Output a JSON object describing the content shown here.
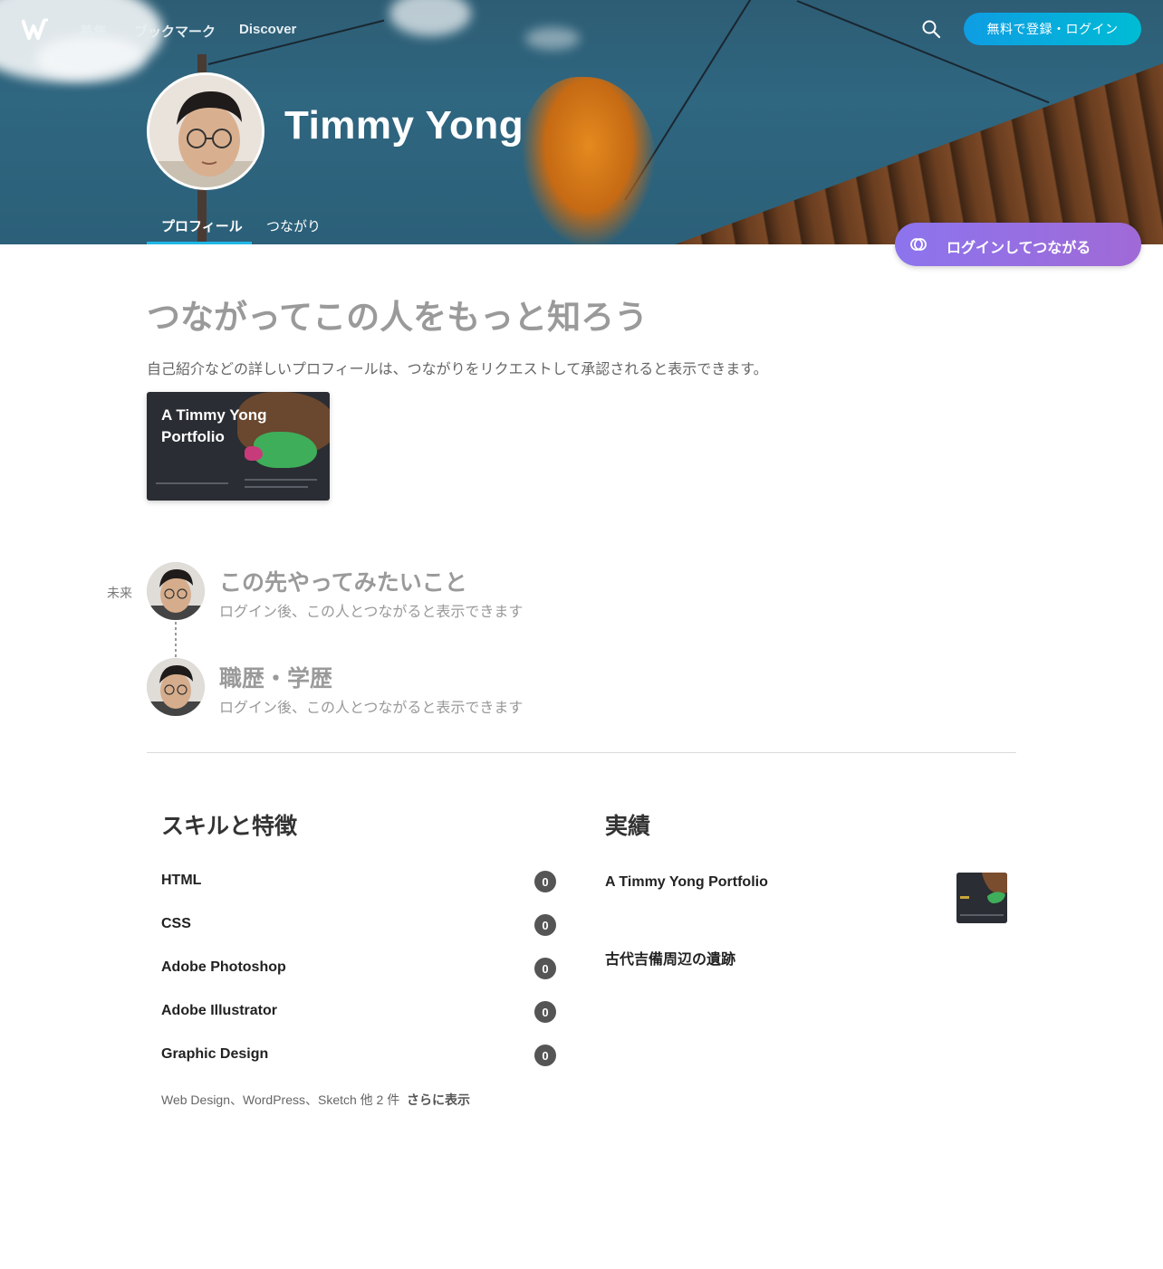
{
  "nav": {
    "logo_alt": "W",
    "links": [
      "募集",
      "ブックマーク",
      "Discover"
    ],
    "signup_label": "無料で登録・ログイン"
  },
  "profile": {
    "name": "Timmy Yong",
    "tabs": [
      "プロフィール",
      "つながり"
    ],
    "active_tab": 0,
    "connect_label": "ログインしてつながる"
  },
  "intro": {
    "heading": "つながってこの人をもっと知ろう",
    "description": "自己紹介などの詳しいプロフィールは、つながりをリクエストして承認されると表示できます。",
    "portfolio_card_title": "A Timmy Yong Portfolio"
  },
  "timeline": {
    "future_label": "未来",
    "items": [
      {
        "title": "この先やってみたいこと",
        "subtitle": "ログイン後、この人とつながると表示できます"
      },
      {
        "title": "職歴・学歴",
        "subtitle": "ログイン後、この人とつながると表示できます"
      }
    ]
  },
  "skills": {
    "title": "スキルと特徴",
    "items": [
      {
        "name": "HTML",
        "count": "0"
      },
      {
        "name": "CSS",
        "count": "0"
      },
      {
        "name": "Adobe Photoshop",
        "count": "0"
      },
      {
        "name": "Adobe Illustrator",
        "count": "0"
      },
      {
        "name": "Graphic Design",
        "count": "0"
      }
    ],
    "more_text": "Web Design、WordPress、Sketch 他 2 件",
    "show_more_label": "さらに表示"
  },
  "works": {
    "title": "実績",
    "items": [
      {
        "title": "A Timmy Yong Portfolio"
      },
      {
        "title": "古代吉備周辺の遺跡"
      }
    ]
  },
  "colors": {
    "accent_blue": "#0e9de3",
    "accent_purple": "#8c74ee",
    "tab_indicator": "#21b8e6"
  }
}
